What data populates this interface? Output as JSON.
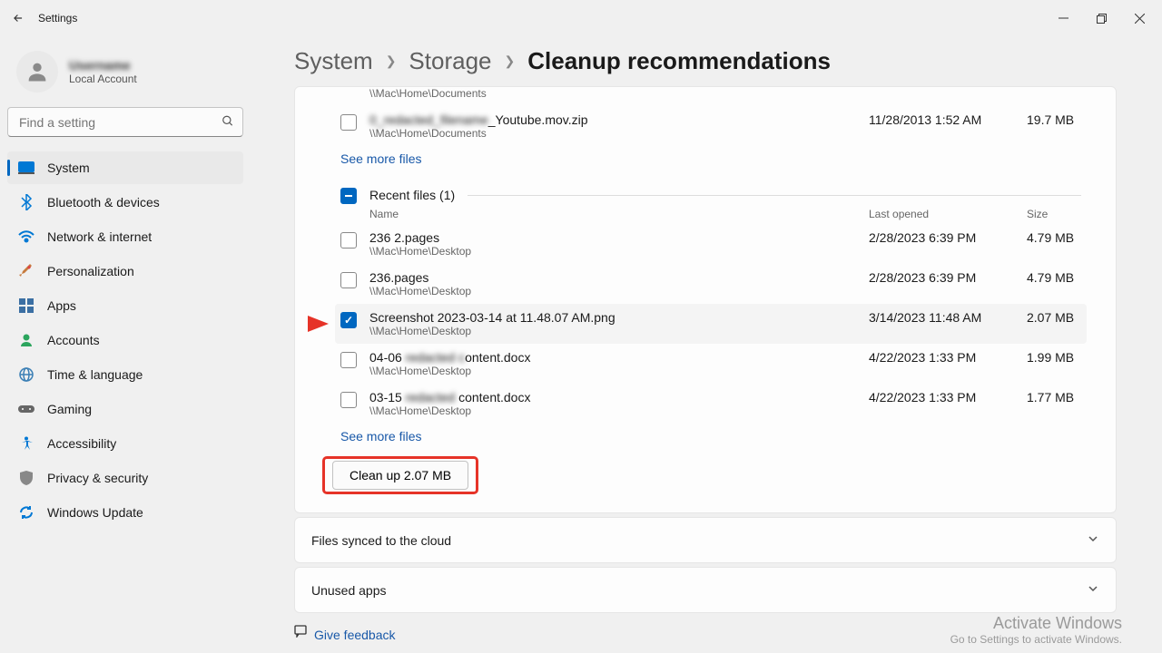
{
  "window": {
    "title": "Settings",
    "account_name": "Username",
    "account_sub": "Local Account"
  },
  "search": {
    "placeholder": "Find a setting"
  },
  "nav": [
    {
      "label": "System"
    },
    {
      "label": "Bluetooth & devices"
    },
    {
      "label": "Network & internet"
    },
    {
      "label": "Personalization"
    },
    {
      "label": "Apps"
    },
    {
      "label": "Accounts"
    },
    {
      "label": "Time & language"
    },
    {
      "label": "Gaming"
    },
    {
      "label": "Accessibility"
    },
    {
      "label": "Privacy & security"
    },
    {
      "label": "Windows Update"
    }
  ],
  "breadcrumb": {
    "seg1": "System",
    "seg2": "Storage",
    "seg3": "Cleanup recommendations"
  },
  "top_files": [
    {
      "name_suffix": "_Youtube.mov.zip",
      "path": "\\\\Mac\\Home\\Documents",
      "date": "11/28/2013 1:52 AM",
      "size": "19.7 MB"
    }
  ],
  "top_path_only": "\\\\Mac\\Home\\Documents",
  "see_more": "See more files",
  "recent": {
    "title": "Recent files (1)",
    "cols": {
      "name": "Name",
      "date": "Last opened",
      "size": "Size"
    },
    "files": [
      {
        "name": "236 2.pages",
        "path": "\\\\Mac\\Home\\Desktop",
        "date": "2/28/2023 6:39 PM",
        "size": "4.79 MB",
        "checked": false
      },
      {
        "name": "236.pages",
        "path": "\\\\Mac\\Home\\Desktop",
        "date": "2/28/2023 6:39 PM",
        "size": "4.79 MB",
        "checked": false
      },
      {
        "name": "Screenshot 2023-03-14 at 11.48.07 AM.png",
        "path": "\\\\Mac\\Home\\Desktop",
        "date": "3/14/2023 11:48 AM",
        "size": "2.07 MB",
        "checked": true
      },
      {
        "name_pre": "04-06 ",
        "name_blur": "redacted c",
        "name_suf": "ontent.docx",
        "path": "\\\\Mac\\Home\\Desktop",
        "date": "4/22/2023 1:33 PM",
        "size": "1.99 MB",
        "checked": false
      },
      {
        "name_pre": "03-15 ",
        "name_blur": "redacted",
        "name_suf": " content.docx",
        "path": "\\\\Mac\\Home\\Desktop",
        "date": "4/22/2023 1:33 PM",
        "size": "1.77 MB",
        "checked": false
      }
    ]
  },
  "cleanup": "Clean up 2.07 MB",
  "panels": {
    "cloud": "Files synced to the cloud",
    "unused": "Unused apps"
  },
  "feedback": "Give feedback",
  "activate": {
    "line1": "Activate Windows",
    "line2": "Go to Settings to activate Windows."
  }
}
